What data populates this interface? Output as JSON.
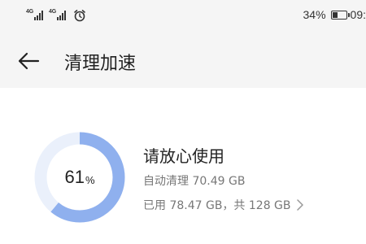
{
  "status_bar": {
    "signal1_label": "4G",
    "signal2_label": "4G",
    "battery_text": "34%",
    "battery_level": 0.34,
    "time_text": "09:"
  },
  "header": {
    "title": "清理加速"
  },
  "storage": {
    "percent_value": "61",
    "percent_unit": "%",
    "percent_fraction": 0.61,
    "headline": "请放心使用",
    "auto_clean_text": "自动清理 70.49 GB",
    "usage_text": "已用 78.47 GB，共 128 GB"
  },
  "colors": {
    "ring_fill": "#8fb0ee",
    "ring_track": "#eaf0fb"
  },
  "icons": {
    "back": "back-arrow-icon",
    "alarm": "alarm-clock-icon",
    "chevron": "chevron-right-icon"
  }
}
